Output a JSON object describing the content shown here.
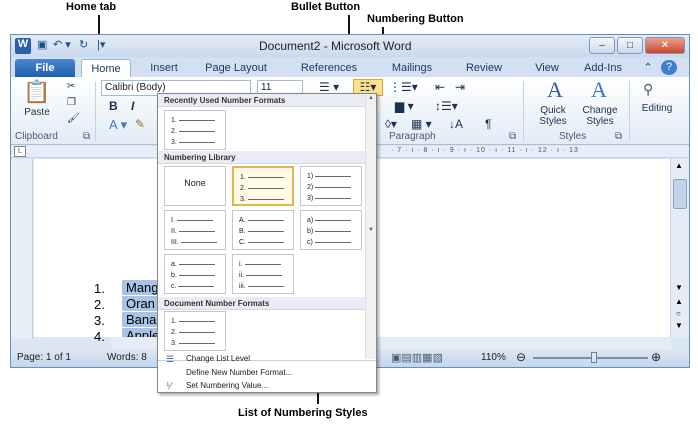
{
  "callouts": {
    "home_tab": "Home tab",
    "bullet_button": "Bullet Button",
    "numbering_button": "Numbering Button",
    "list_styles": "List of Numbering  Styles"
  },
  "window": {
    "title": "Document2  -  Microsoft Word",
    "controls": {
      "minimize": "–",
      "maximize": "□",
      "close": "✕"
    }
  },
  "tabs": [
    "File",
    "Home",
    "Insert",
    "Page Layout",
    "References",
    "Mailings",
    "Review",
    "View",
    "Add-Ins"
  ],
  "ribbon": {
    "paste_label": "Paste",
    "clipboard_label": "Clipboard",
    "font_name": "Calibri (Body)",
    "font_size": "11",
    "bold": "B",
    "italic": "I",
    "paragraph_label": "Paragraph",
    "quick_styles": "Quick Styles",
    "change_styles": "Change Styles",
    "styles_label": "Styles",
    "editing_label": "Editing"
  },
  "ruler_ticks": "· 7 · ı · 8 · ı · 9 · ı · 10 · ı · 11 · ı · 12 · ı · 13",
  "document": {
    "numbers": [
      "1.",
      "2.",
      "3.",
      "4."
    ],
    "items": [
      "Mang",
      "Oran",
      "Bana",
      "Apple"
    ]
  },
  "status": {
    "page": "Page: 1 of 1",
    "words": "Words: 8",
    "zoom": "110%"
  },
  "dropdown": {
    "recent_header": "Recently Used Number Formats",
    "library_header": "Numbering Library",
    "document_header": "Document Number Formats",
    "none_label": "None",
    "recent_formats": [
      [
        "1.",
        "2.",
        "3."
      ]
    ],
    "library_formats": [
      [
        "1.",
        "2.",
        "3."
      ],
      [
        "1)",
        "2)",
        "3)"
      ],
      [
        "I.",
        "II.",
        "III."
      ],
      [
        "A.",
        "B.",
        "C."
      ],
      [
        "a)",
        "b)",
        "c)"
      ],
      [
        "a.",
        "b.",
        "c."
      ],
      [
        "i.",
        "ii.",
        "iii."
      ]
    ],
    "document_formats": [
      [
        "1.",
        "2.",
        "3."
      ]
    ],
    "menu": [
      "Change List Level",
      "Define New Number Format...",
      "Set Numbering Value..."
    ]
  }
}
